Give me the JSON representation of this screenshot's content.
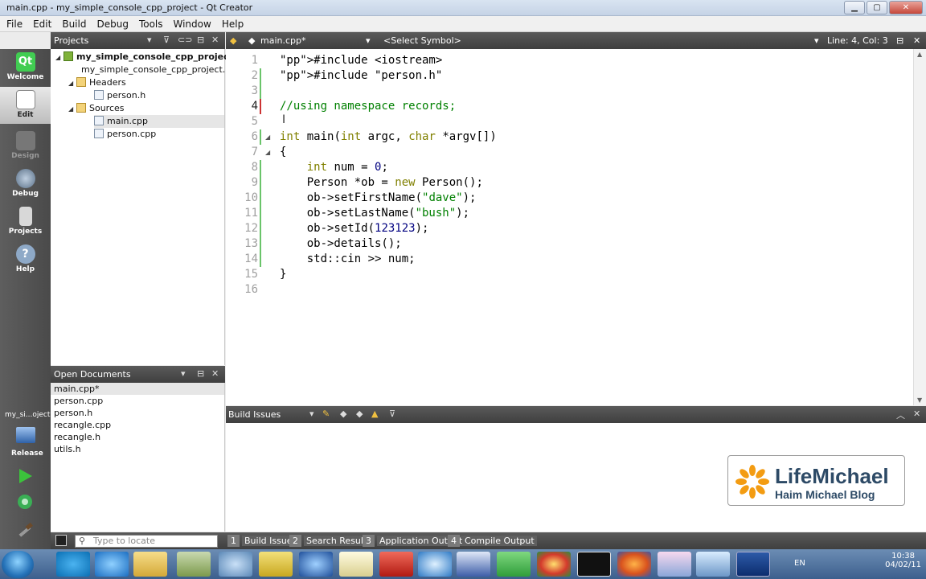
{
  "window": {
    "title": "main.cpp - my_simple_console_cpp_project - Qt Creator"
  },
  "window_controls": {
    "minimize": "▁",
    "maximize": "▢",
    "close": "✕"
  },
  "menu": [
    "File",
    "Edit",
    "Build",
    "Debug",
    "Tools",
    "Window",
    "Help"
  ],
  "modes": [
    {
      "label": "Welcome",
      "icon": "qt-logo-icon"
    },
    {
      "label": "Edit",
      "icon": "edit-document-icon"
    },
    {
      "label": "Design",
      "icon": "design-icon"
    },
    {
      "label": "Debug",
      "icon": "debug-icon"
    },
    {
      "label": "Projects",
      "icon": "projects-icon"
    },
    {
      "label": "Help",
      "icon": "help-icon"
    }
  ],
  "projects_panel": {
    "title": "Projects",
    "tree": [
      {
        "label": "my_simple_console_cpp_project",
        "level": 0,
        "kind": "project"
      },
      {
        "label": "my_simple_console_cpp_project.pro",
        "level": 1,
        "kind": "file"
      },
      {
        "label": "Headers",
        "level": 1,
        "kind": "folder"
      },
      {
        "label": "person.h",
        "level": 2,
        "kind": "file"
      },
      {
        "label": "Sources",
        "level": 1,
        "kind": "folder"
      },
      {
        "label": "main.cpp",
        "level": 2,
        "kind": "file",
        "selected": true
      },
      {
        "label": "person.cpp",
        "level": 2,
        "kind": "file"
      }
    ]
  },
  "editor": {
    "file_tab": "main.cpp*",
    "symbol": "<Select Symbol>",
    "position": "Line: 4, Col: 3",
    "current_line": 4,
    "lines": [
      "#include <iostream>",
      "#include \"person.h\"",
      "",
      "//using namespace records;",
      "",
      "int main(int argc, char *argv[])",
      "{",
      "    int num = 0;",
      "    Person *ob = new Person();",
      "    ob->setFirstName(\"dave\");",
      "    ob->setLastName(\"bush\");",
      "    ob->setId(123123);",
      "    ob->details();",
      "    std::cin >> num;",
      "}",
      ""
    ]
  },
  "open_documents": {
    "title": "Open Documents",
    "items": [
      "main.cpp*",
      "person.cpp",
      "person.h",
      "recangle.cpp",
      "recangle.h",
      "utils.h"
    ]
  },
  "build_issues": {
    "title": "Build Issues"
  },
  "target": {
    "project": "my_si...oject",
    "config": "Release"
  },
  "output_bar": {
    "locate_placeholder": "Type to locate",
    "tabs": [
      {
        "num": "1",
        "label": "Build Issues"
      },
      {
        "num": "2",
        "label": "Search Results"
      },
      {
        "num": "3",
        "label": "Application Output"
      },
      {
        "num": "4",
        "label": "Compile Output"
      }
    ]
  },
  "watermark": {
    "brand": "LifeMichael",
    "subtitle": "Haim Michael Blog"
  },
  "taskbar": {
    "lang": "EN",
    "time": "10:38",
    "date": "04/02/11"
  }
}
